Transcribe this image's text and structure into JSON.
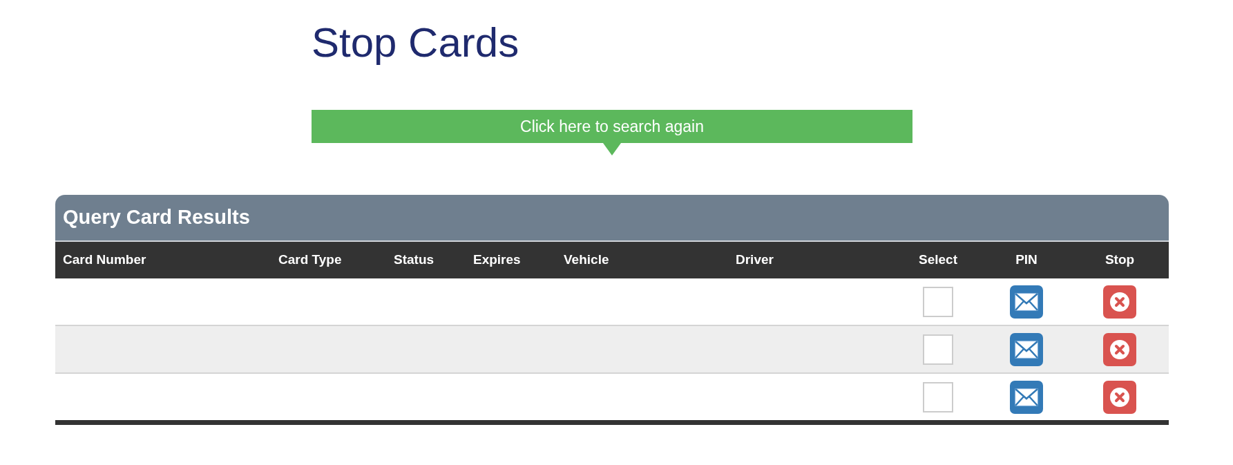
{
  "page_title": "Stop Cards",
  "search_again_button": {
    "label": "Click here to search again"
  },
  "results": {
    "title": "Query Card Results",
    "columns": [
      {
        "label": "Card Number"
      },
      {
        "label": "Card Type"
      },
      {
        "label": "Status"
      },
      {
        "label": "Expires"
      },
      {
        "label": "Vehicle"
      },
      {
        "label": "Driver"
      },
      {
        "label": "Select"
      },
      {
        "label": "PIN"
      },
      {
        "label": "Stop"
      }
    ],
    "rows": [
      {
        "checked": false
      },
      {
        "checked": false
      },
      {
        "checked": false
      }
    ]
  }
}
